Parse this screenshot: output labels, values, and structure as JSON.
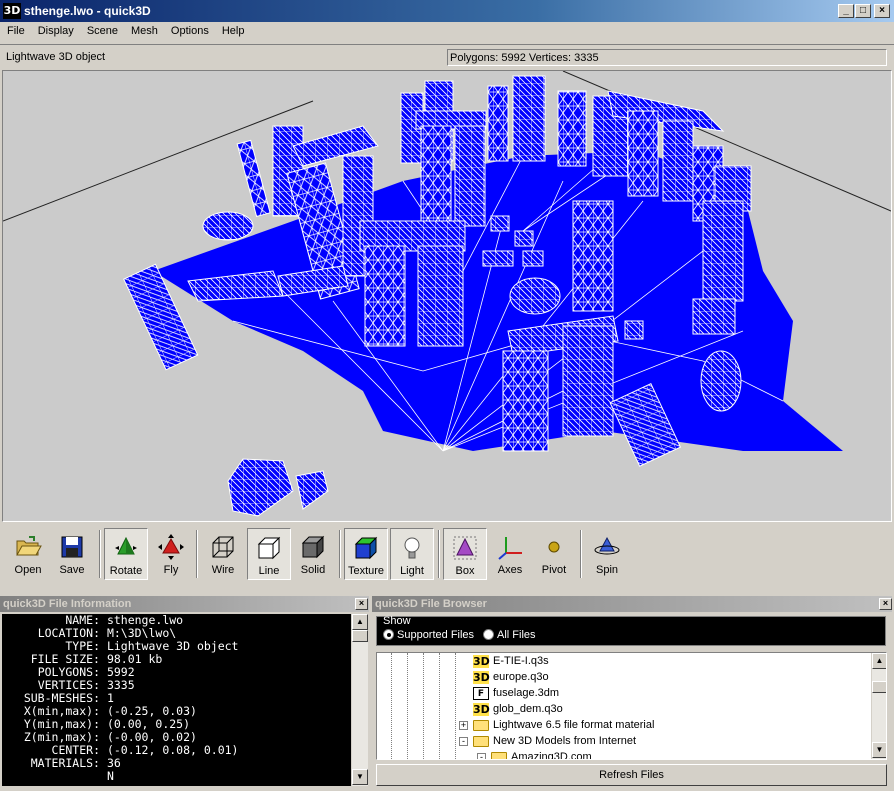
{
  "window": {
    "title": "sthenge.lwo - quick3D",
    "app_icon": "3D"
  },
  "menu": [
    "File",
    "Display",
    "Scene",
    "Mesh",
    "Options",
    "Help"
  ],
  "status": {
    "object_type": "Lightwave 3D object",
    "stats": "Polygons: 5992  Vertices: 3335"
  },
  "toolbar": [
    {
      "id": "open",
      "label": "Open",
      "icon": "folder-open-icon",
      "pressed": false
    },
    {
      "id": "save",
      "label": "Save",
      "icon": "floppy-disk-icon",
      "pressed": false
    },
    {
      "id": "rotate",
      "label": "Rotate",
      "icon": "rotate-icon",
      "pressed": true
    },
    {
      "id": "fly",
      "label": "Fly",
      "icon": "fly-icon",
      "pressed": false
    },
    {
      "id": "wire",
      "label": "Wire",
      "icon": "wire-cube-icon",
      "pressed": false
    },
    {
      "id": "line",
      "label": "Line",
      "icon": "line-cube-icon",
      "pressed": true
    },
    {
      "id": "solid",
      "label": "Solid",
      "icon": "solid-cube-icon",
      "pressed": false
    },
    {
      "id": "texture",
      "label": "Texture",
      "icon": "texture-cube-icon",
      "pressed": true
    },
    {
      "id": "light",
      "label": "Light",
      "icon": "light-bulb-icon",
      "pressed": true
    },
    {
      "id": "box",
      "label": "Box",
      "icon": "bounding-box-icon",
      "pressed": true
    },
    {
      "id": "axes",
      "label": "Axes",
      "icon": "axes-icon",
      "pressed": false
    },
    {
      "id": "pivot",
      "label": "Pivot",
      "icon": "pivot-icon",
      "pressed": false
    },
    {
      "id": "spin",
      "label": "Spin",
      "icon": "spin-icon",
      "pressed": false
    }
  ],
  "info_panel": {
    "title": "quick3D File Information",
    "rows": [
      {
        "key": "NAME:",
        "value": "sthenge.lwo"
      },
      {
        "key": "LOCATION:",
        "value": "M:\\3D\\lwo\\"
      },
      {
        "key": "TYPE:",
        "value": "Lightwave 3D object"
      },
      {
        "key": "FILE SIZE:",
        "value": "98.01 kb"
      },
      {
        "key": "POLYGONS:",
        "value": "5992"
      },
      {
        "key": "VERTICES:",
        "value": "3335"
      },
      {
        "key": "SUB-MESHES:",
        "value": "1"
      },
      {
        "key": "X(min,max):",
        "value": "(-0.25, 0.03)"
      },
      {
        "key": "Y(min,max):",
        "value": "(0.00, 0.25)"
      },
      {
        "key": "Z(min,max):",
        "value": "(-0.00, 0.02)"
      },
      {
        "key": "CENTER:",
        "value": "(-0.12, 0.08, 0.01)"
      },
      {
        "key": "MATERIALS:",
        "value": "36"
      },
      {
        "key": "",
        "value": "N"
      }
    ]
  },
  "browser_panel": {
    "title": "quick3D File Browser",
    "show_legend": "Show",
    "filter_supported": "Supported Files",
    "filter_all": "All Files",
    "filter_selected": "supported",
    "items": [
      {
        "label": "E-TIE-I.q3s",
        "kind": "3d",
        "level": 2
      },
      {
        "label": "europe.q3o",
        "kind": "3d",
        "level": 2
      },
      {
        "label": "fuselage.3dm",
        "kind": "file",
        "level": 2
      },
      {
        "label": "glob_dem.q3o",
        "kind": "3d",
        "level": 2
      },
      {
        "label": "Lightwave 6.5 file format material",
        "kind": "folder",
        "expander": "+",
        "level": 1
      },
      {
        "label": "New 3D Models from Internet",
        "kind": "folder",
        "expander": "-",
        "level": 1
      },
      {
        "label": "Amazing3D.com",
        "kind": "folder",
        "expander": "-",
        "level": 2
      }
    ],
    "refresh_label": "Refresh Files"
  },
  "colors": {
    "mesh": "#0000ff",
    "viewport_bg": "#cbcbcb",
    "title_active": "#0a246a"
  }
}
